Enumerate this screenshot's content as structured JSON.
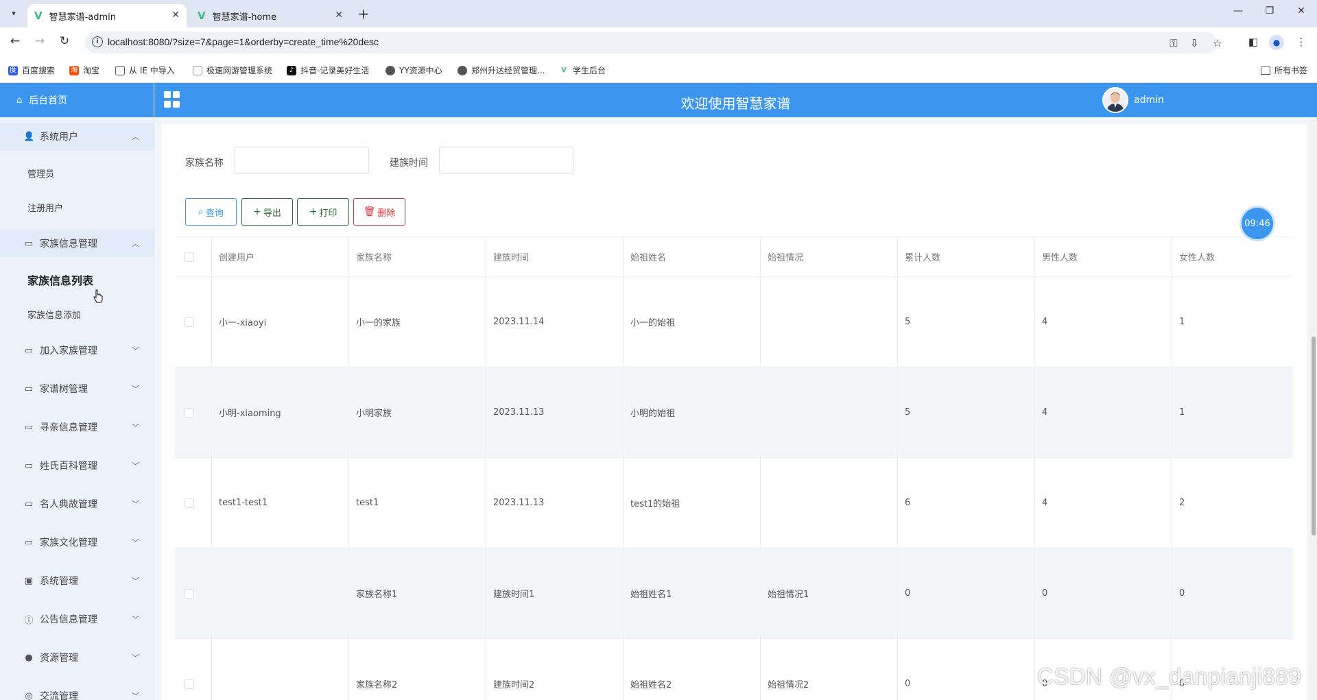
{
  "browser": {
    "tabs": [
      {
        "title": "智慧家谱-admin",
        "active": true
      },
      {
        "title": "智慧家谱-home",
        "active": false
      }
    ],
    "url": "localhost:8080/?size=7&page=1&orderby=create_time%20desc",
    "bookmarks": [
      "百度搜索",
      "淘宝",
      "从 IE 中导入",
      "极速网游管理系统",
      "抖音-记录美好生活",
      "YY资源中心",
      "郑州升达经贸管理...",
      "学生后台"
    ],
    "all_bookmarks": "所有书签"
  },
  "topbar": {
    "title": "欢迎使用智慧家谱",
    "user": "admin"
  },
  "sidebar": {
    "home": "后台首页",
    "menus": [
      {
        "label": "系统用户",
        "icon": "user-icon",
        "open": true,
        "children": [
          "管理员",
          "注册用户"
        ]
      },
      {
        "label": "家族信息管理",
        "icon": "folder-icon",
        "open": true,
        "children": [
          "家族信息列表",
          "家族信息添加"
        ]
      },
      {
        "label": "加入家族管理",
        "icon": "folder-icon"
      },
      {
        "label": "家谱树管理",
        "icon": "folder-icon"
      },
      {
        "label": "寻亲信息管理",
        "icon": "folder-icon"
      },
      {
        "label": "姓氏百科管理",
        "icon": "folder-icon"
      },
      {
        "label": "名人典故管理",
        "icon": "folder-icon"
      },
      {
        "label": "家族文化管理",
        "icon": "folder-icon"
      },
      {
        "label": "系统管理",
        "icon": "picture-icon"
      },
      {
        "label": "公告信息管理",
        "icon": "info-icon"
      },
      {
        "label": "资源管理",
        "icon": "pin-icon"
      },
      {
        "label": "交流管理",
        "icon": "chat-icon"
      }
    ]
  },
  "search": {
    "family_name_label": "家族名称",
    "found_time_label": "建族时间",
    "family_name_value": "",
    "found_time_value": ""
  },
  "actions": {
    "query": "查询",
    "export": "导出",
    "print": "打印",
    "delete": "删除"
  },
  "table": {
    "headers": [
      "创建用户",
      "家族名称",
      "建族时间",
      "始祖姓名",
      "始祖情况",
      "累计人数",
      "男性人数",
      "女性人数"
    ],
    "rows": [
      [
        "小一-xiaoyi",
        "小一的家族",
        "2023.11.14",
        "小一的始祖",
        "",
        "5",
        "4",
        "1"
      ],
      [
        "小明-xiaoming",
        "小明家族",
        "2023.11.13",
        "小明的始祖",
        "",
        "5",
        "4",
        "1"
      ],
      [
        "test1-test1",
        "test1",
        "2023.11.13",
        "test1的始祖",
        "",
        "6",
        "4",
        "2"
      ],
      [
        "",
        "家族名称1",
        "建族时间1",
        "始祖姓名1",
        "始祖情况1",
        "0",
        "0",
        "0"
      ],
      [
        "",
        "家族名称2",
        "建族时间2",
        "始祖姓名2",
        "始祖情况2",
        "0",
        "0",
        "0"
      ]
    ]
  },
  "clock": "09:46",
  "watermark": "CSDN @vx_danpianji889",
  "colors": {
    "accent": "#3c96f0",
    "sidebar_bg": "#ebf2fa",
    "danger": "#d9363e",
    "success": "#2b6b35"
  }
}
